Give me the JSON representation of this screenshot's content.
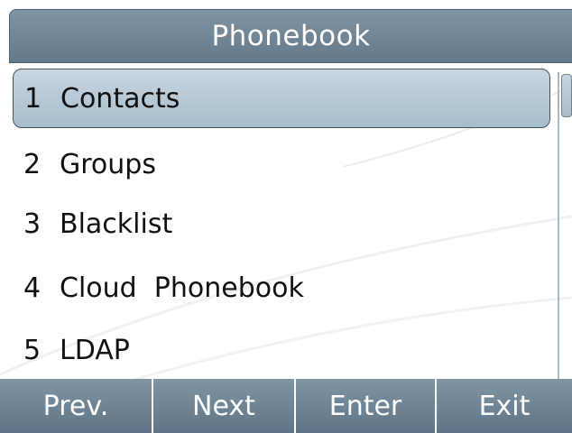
{
  "title": "Phonebook",
  "menu": {
    "items": [
      {
        "number": "1",
        "label": "Contacts"
      },
      {
        "number": "2",
        "label": "Groups"
      },
      {
        "number": "3",
        "label": "Blacklist"
      },
      {
        "number": "4",
        "label": "Cloud  Phonebook"
      },
      {
        "number": "5",
        "label": "LDAP"
      }
    ],
    "selected_index": 0
  },
  "softkeys": [
    {
      "label": "Prev."
    },
    {
      "label": "Next"
    },
    {
      "label": "Enter"
    },
    {
      "label": "Exit"
    }
  ],
  "colors": {
    "header": "#6f8696",
    "selection": "#b8cad6",
    "softkey": "#6f8696"
  }
}
